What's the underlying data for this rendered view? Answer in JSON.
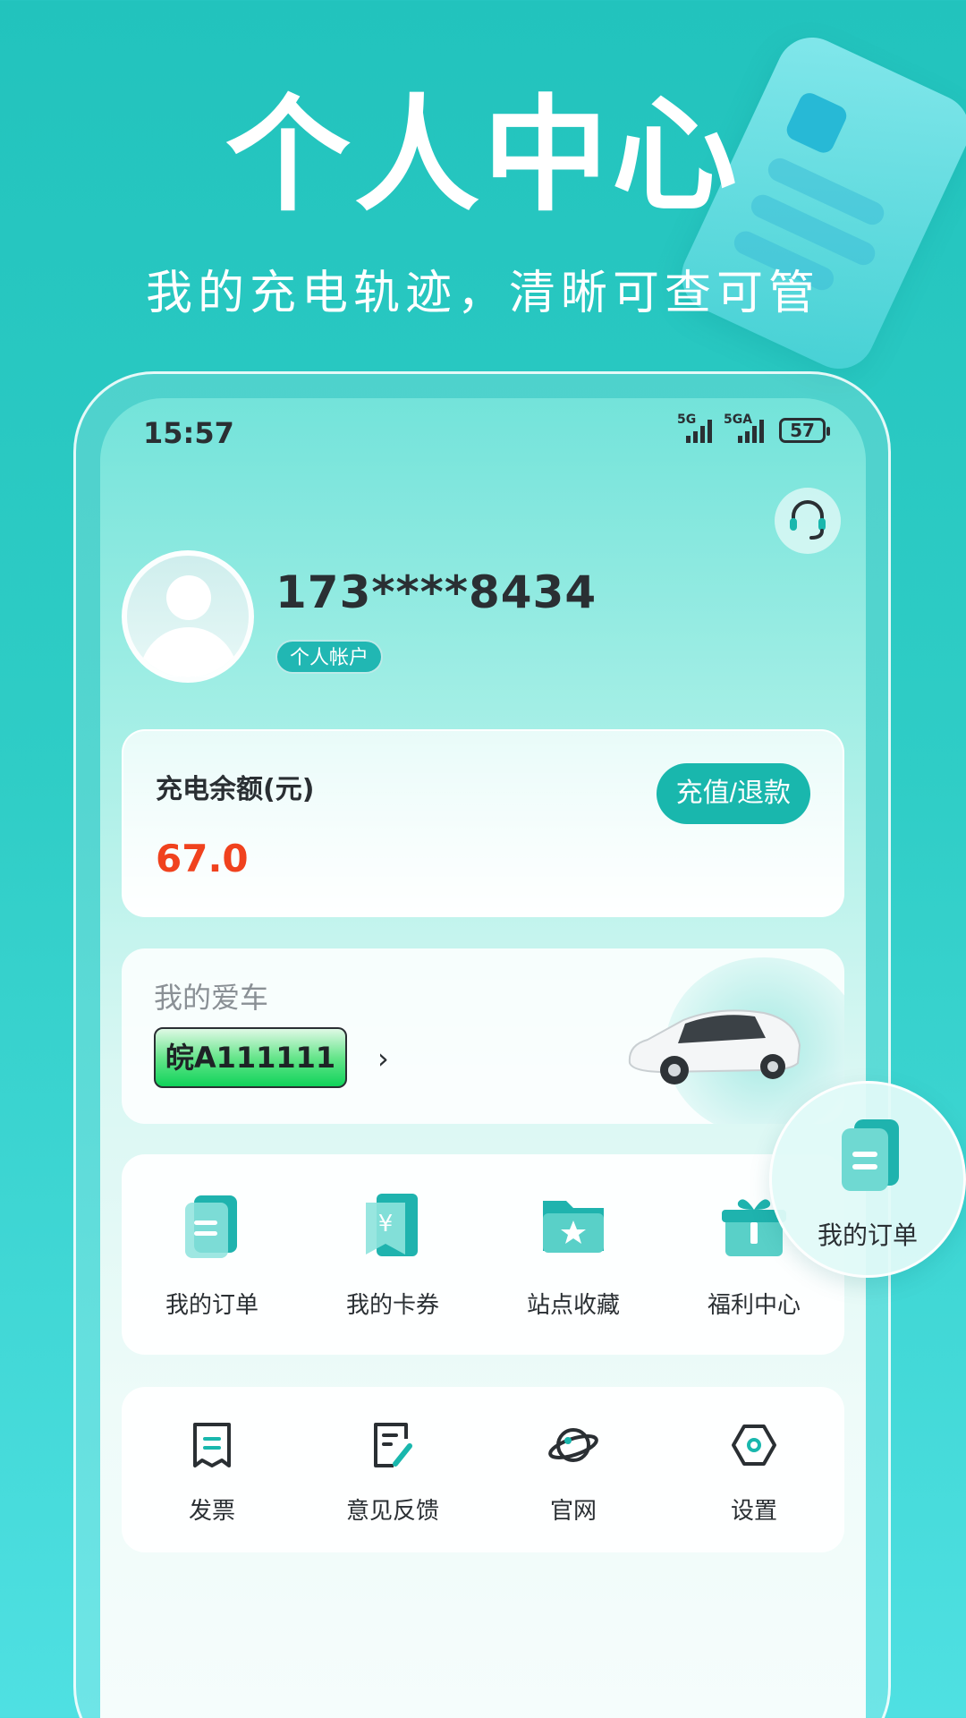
{
  "promo": {
    "title": "个人中心",
    "subtitle": "我的充电轨迹，清晰可查可管"
  },
  "status_bar": {
    "time": "15:57",
    "signal1": "5G",
    "signal2": "5GA",
    "battery": "57"
  },
  "profile": {
    "phone": "173****8434",
    "account_type": "个人帐户",
    "service_icon": "headset-icon"
  },
  "balance": {
    "label": "充电余额(元)",
    "value": "67.0",
    "action": "充值/退款",
    "value_color": "#f0421e"
  },
  "car": {
    "label": "我的爱车",
    "plate": "皖A111111",
    "arrow": "›"
  },
  "quick_menu": [
    {
      "label": "我的订单",
      "icon": "order-icon"
    },
    {
      "label": "我的卡券",
      "icon": "coupon-icon"
    },
    {
      "label": "站点收藏",
      "icon": "folder-star-icon"
    },
    {
      "label": "福利中心",
      "icon": "gift-icon"
    }
  ],
  "tools_menu": [
    {
      "label": "发票",
      "icon": "receipt-icon"
    },
    {
      "label": "意见反馈",
      "icon": "feedback-icon"
    },
    {
      "label": "官网",
      "icon": "planet-icon"
    },
    {
      "label": "设置",
      "icon": "settings-icon"
    }
  ],
  "floating": {
    "label": "我的订单",
    "icon": "order-icon"
  },
  "colors": {
    "accent": "#19b7ad",
    "background": "#2fcdc6"
  }
}
